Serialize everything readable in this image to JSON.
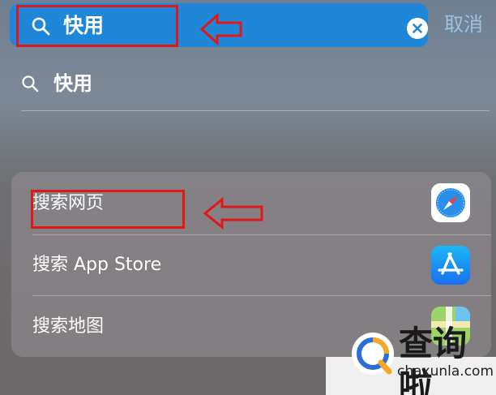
{
  "search": {
    "query": "快用",
    "cancel_label": "取消"
  },
  "suggestion": {
    "text": "快用"
  },
  "actions": [
    {
      "label": "搜索网页",
      "icon": "safari-icon"
    },
    {
      "label": "搜索 App Store",
      "icon": "app-store-icon"
    },
    {
      "label": "搜索地图",
      "icon": "maps-icon"
    }
  ],
  "watermark": {
    "text": "查询啦",
    "domain": "chaxunla.com"
  },
  "colors": {
    "search_bar": "#1f86d8",
    "annotation_red": "#e01818"
  }
}
